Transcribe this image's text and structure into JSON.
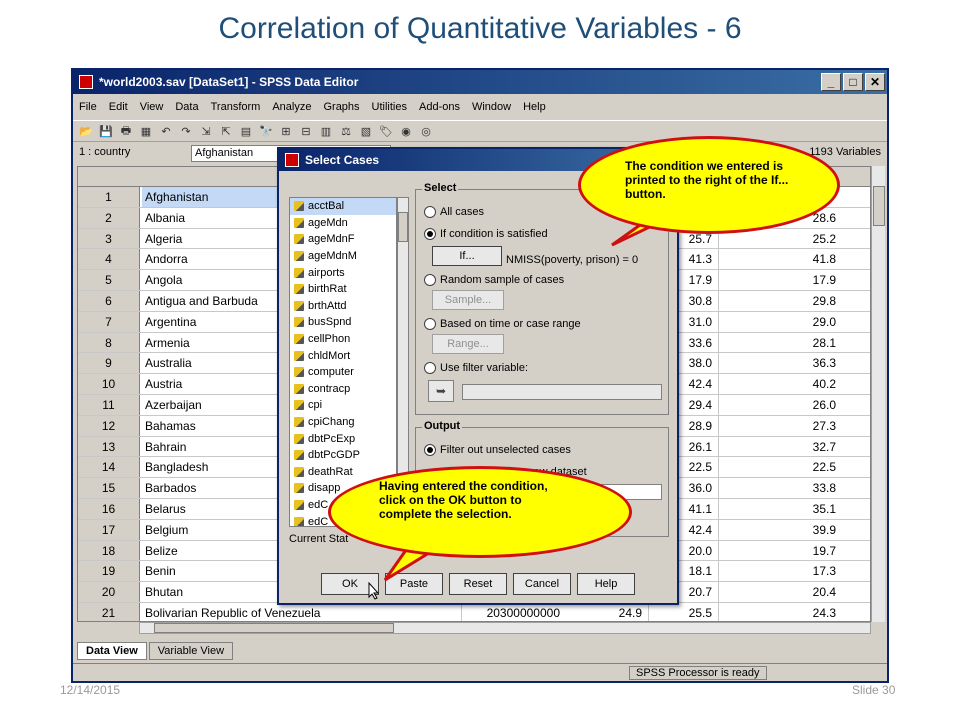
{
  "slide": {
    "title": "Correlation of Quantitative Variables - 6",
    "date": "12/14/2015",
    "slide_number": "Slide 30"
  },
  "window": {
    "title": "*world2003.sav [DataSet1] - SPSS Data Editor",
    "menu": [
      "File",
      "Edit",
      "View",
      "Data",
      "Transform",
      "Analyze",
      "Graphs",
      "Utilities",
      "Add-ons",
      "Window",
      "Help"
    ],
    "cell_ref": "1 : country",
    "cell_value": "Afghanistan",
    "var_count": "1193 Variables",
    "tabs": [
      "Data View",
      "Variable View"
    ],
    "status": "SPSS  Processor is ready"
  },
  "grid": {
    "rows": [
      {
        "n": "1",
        "country": "Afghanistan",
        "gdp": "",
        "c1": "",
        "c2": "",
        "c3": ""
      },
      {
        "n": "2",
        "country": "Albania",
        "gdp": "",
        "c1": "",
        "c2": "",
        "c3": "28.6"
      },
      {
        "n": "3",
        "country": "Algeria",
        "gdp": "",
        "c1": "",
        "c2": "25.7",
        "c3": "25.2"
      },
      {
        "n": "4",
        "country": "Andorra",
        "gdp": "",
        "c1": "",
        "c2": "41.3",
        "c3": "41.8"
      },
      {
        "n": "5",
        "country": "Angola",
        "gdp": "",
        "c1": "",
        "c2": "17.9",
        "c3": "17.9"
      },
      {
        "n": "6",
        "country": "Antigua and Barbuda",
        "gdp": "",
        "c1": "",
        "c2": "30.8",
        "c3": "29.8"
      },
      {
        "n": "7",
        "country": "Argentina",
        "gdp": "",
        "c1": "",
        "c2": "31.0",
        "c3": "29.0"
      },
      {
        "n": "8",
        "country": "Armenia",
        "gdp": "",
        "c1": "",
        "c2": "33.6",
        "c3": "28.1"
      },
      {
        "n": "9",
        "country": "Australia",
        "gdp": "",
        "c1": "",
        "c2": "38.0",
        "c3": "36.3"
      },
      {
        "n": "10",
        "country": "Austria",
        "gdp": "",
        "c1": "",
        "c2": "42.4",
        "c3": "40.2"
      },
      {
        "n": "11",
        "country": "Azerbaijan",
        "gdp": "",
        "c1": "",
        "c2": "29.4",
        "c3": "26.0"
      },
      {
        "n": "12",
        "country": "Bahamas",
        "gdp": "",
        "c1": "",
        "c2": "28.9",
        "c3": "27.3"
      },
      {
        "n": "13",
        "country": "Bahrain",
        "gdp": "",
        "c1": "",
        "c2": "26.1",
        "c3": "32.7"
      },
      {
        "n": "14",
        "country": "Bangladesh",
        "gdp": "",
        "c1": "",
        "c2": "22.5",
        "c3": "22.5"
      },
      {
        "n": "15",
        "country": "Barbados",
        "gdp": "",
        "c1": "",
        "c2": "36.0",
        "c3": "33.8"
      },
      {
        "n": "16",
        "country": "Belarus",
        "gdp": "",
        "c1": "",
        "c2": "41.1",
        "c3": "35.1"
      },
      {
        "n": "17",
        "country": "Belgium",
        "gdp": "",
        "c1": "",
        "c2": "42.4",
        "c3": "39.9"
      },
      {
        "n": "18",
        "country": "Belize",
        "gdp": "",
        "c1": "",
        "c2": "20.0",
        "c3": "19.7"
      },
      {
        "n": "19",
        "country": "Benin",
        "gdp": "",
        "c1": "",
        "c2": "18.1",
        "c3": "17.3"
      },
      {
        "n": "20",
        "country": "Bhutan",
        "gdp": "",
        "c1": "",
        "c2": "20.7",
        "c3": "20.4"
      },
      {
        "n": "21",
        "country": "Bolivarian Republic of Venezuela",
        "gdp": "20300000000",
        "c1": "24.9",
        "c2": "25.5",
        "c3": "24.3"
      }
    ]
  },
  "dialog": {
    "title": "Select Cases",
    "variables": [
      "acctBal",
      "ageMdn",
      "ageMdnF",
      "ageMdnM",
      "airports",
      "birthRat",
      "brthAttd",
      "busSpnd",
      "cellPhon",
      "chldMort",
      "computer",
      "contracp",
      "cpi",
      "cpiChang",
      "dbtPcExp",
      "dbtPcGDP",
      "deathRat",
      "disapp",
      "edC",
      "edC"
    ],
    "current_status": "Current Stat",
    "select_label": "Select",
    "all_cases": "All cases",
    "if_condition": "If condition is satisfied",
    "if_button": "If...",
    "condition": "NMISS(poverty, prison) = 0",
    "random_sample": "Random sample of cases",
    "sample_button": "Sample...",
    "time_range": "Based on time or case range",
    "range_button": "Range...",
    "filter_var": "Use filter variable:",
    "output_label": "Output",
    "filter_out": "Filter out unselected cases",
    "copy_new": "to a new dataset",
    "buttons": [
      "OK",
      "Paste",
      "Reset",
      "Cancel",
      "Help"
    ]
  },
  "callouts": {
    "top": "The condition we entered is printed to the right of the If... button.",
    "bottom": "Having entered the condition, click on the OK button to complete the selection."
  },
  "colors": {
    "callout_fill": "#ffff00",
    "callout_border": "#d01010",
    "title_color": "#1f4e79"
  }
}
